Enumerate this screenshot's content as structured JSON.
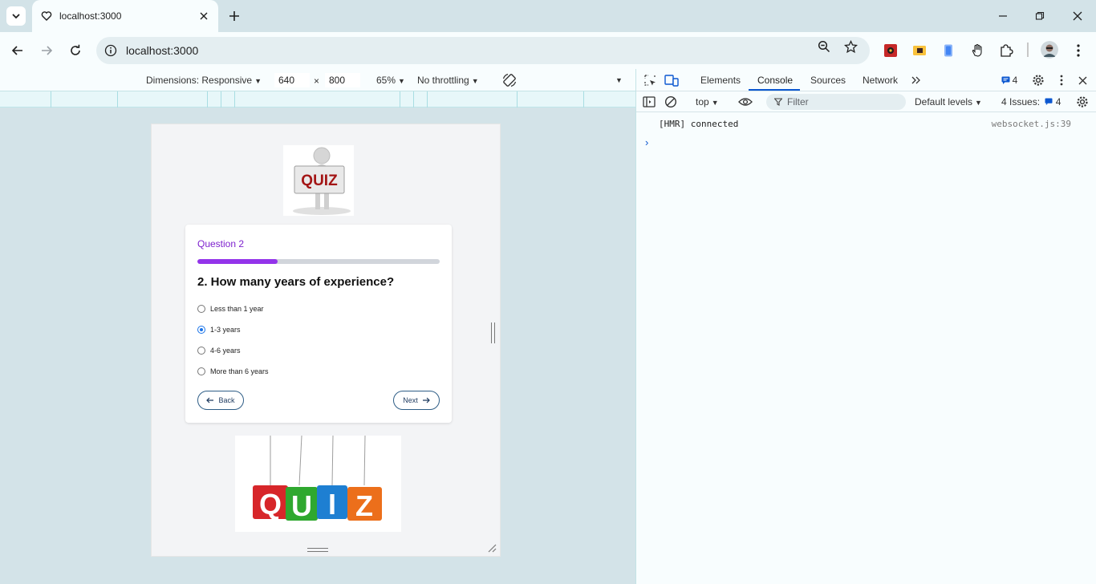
{
  "browser": {
    "tab_title": "localhost:3000",
    "url": "localhost:3000"
  },
  "device_toolbar": {
    "dimensions_label": "Dimensions: Responsive",
    "width_value": "640",
    "times": "×",
    "height_value": "800",
    "zoom": "65%",
    "throttling": "No throttling"
  },
  "quiz": {
    "top_image_text": "QUIZ",
    "question_label": "Question 2",
    "progress": 0.33,
    "question_text": "2. How many years of experience?",
    "options": [
      {
        "label": "Less than 1 year",
        "checked": false
      },
      {
        "label": "1-3 years",
        "checked": true
      },
      {
        "label": "4-6 years",
        "checked": false
      },
      {
        "label": "More than 6 years",
        "checked": false
      }
    ],
    "back_label": "Back",
    "next_label": "Next",
    "bottom_image_letters": [
      "Q",
      "U",
      "I",
      "Z"
    ]
  },
  "devtools": {
    "tabs": [
      "Elements",
      "Console",
      "Sources",
      "Network"
    ],
    "active_tab": "Console",
    "message_count": "4",
    "context": "top",
    "filter_placeholder": "Filter",
    "levels": "Default levels",
    "issues_label": "4 Issues:",
    "issues_count": "4",
    "console_message": "[HMR] connected",
    "console_source": "websocket.js:39",
    "prompt_symbol": "›"
  },
  "colors": {
    "accent_purple": "#9333ea",
    "radio_blue": "#1a73e8",
    "devtools_blue": "#0b57d0"
  }
}
